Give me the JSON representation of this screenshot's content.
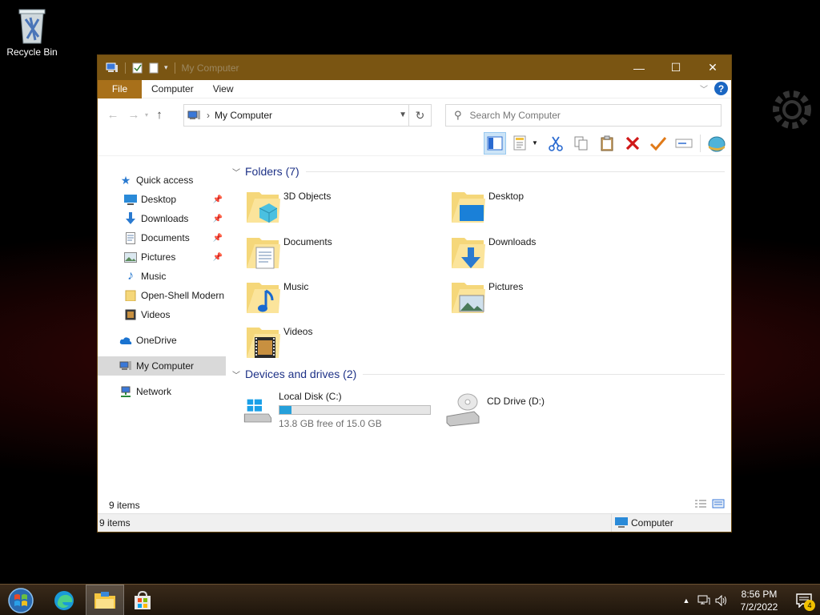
{
  "desktop": {
    "icons": [
      {
        "label": "Recycle Bin",
        "icon": "recycle-bin-icon"
      }
    ]
  },
  "window": {
    "title": "My Computer",
    "controls": {
      "minimize": "—",
      "maximize": "☐",
      "close": "✕"
    }
  },
  "ribbon": {
    "tabs": [
      {
        "label": "File"
      },
      {
        "label": "Computer"
      },
      {
        "label": "View"
      }
    ]
  },
  "navigation": {
    "address_path": "My Computer",
    "address_separator": "›",
    "search_placeholder": "Search My Computer"
  },
  "toolbar": {
    "buttons": [
      "preview-pane-icon",
      "properties-icon",
      "cut-icon",
      "copy-icon",
      "paste-icon",
      "delete-icon",
      "select-icon",
      "rename-icon",
      "internet-icon"
    ]
  },
  "sidebar": {
    "quick_access": {
      "label": "Quick access"
    },
    "quick_items": [
      {
        "label": "Desktop",
        "pinned": true
      },
      {
        "label": "Downloads",
        "pinned": true
      },
      {
        "label": "Documents",
        "pinned": true
      },
      {
        "label": "Pictures",
        "pinned": true
      },
      {
        "label": "Music",
        "pinned": false
      },
      {
        "label": "Open-Shell Modern",
        "pinned": false
      },
      {
        "label": "Videos",
        "pinned": false
      }
    ],
    "onedrive": {
      "label": "OneDrive"
    },
    "my_computer": {
      "label": "My Computer"
    },
    "network": {
      "label": "Network"
    }
  },
  "main": {
    "folders_header": "Folders (7)",
    "folders": [
      {
        "name": "3D Objects"
      },
      {
        "name": "Desktop"
      },
      {
        "name": "Documents"
      },
      {
        "name": "Downloads"
      },
      {
        "name": "Music"
      },
      {
        "name": "Pictures"
      },
      {
        "name": "Videos"
      }
    ],
    "drives_header": "Devices and drives (2)",
    "drives": [
      {
        "name": "Local Disk (C:)",
        "free_text": "13.8 GB free of 15.0 GB",
        "used_fraction": 0.08
      },
      {
        "name": "CD Drive (D:)"
      }
    ],
    "item_count": "9 items"
  },
  "statusbar": {
    "left": "9 items",
    "zone": "Computer"
  },
  "taskbar": {
    "clock_time": "8:56 PM",
    "clock_date": "7/2/2022",
    "notification_count": "4"
  },
  "colors": {
    "titlebar": "#7a5512",
    "file_tab": "#a8701a",
    "group_header": "#1e3287",
    "drive_fill": "#26a0da"
  }
}
